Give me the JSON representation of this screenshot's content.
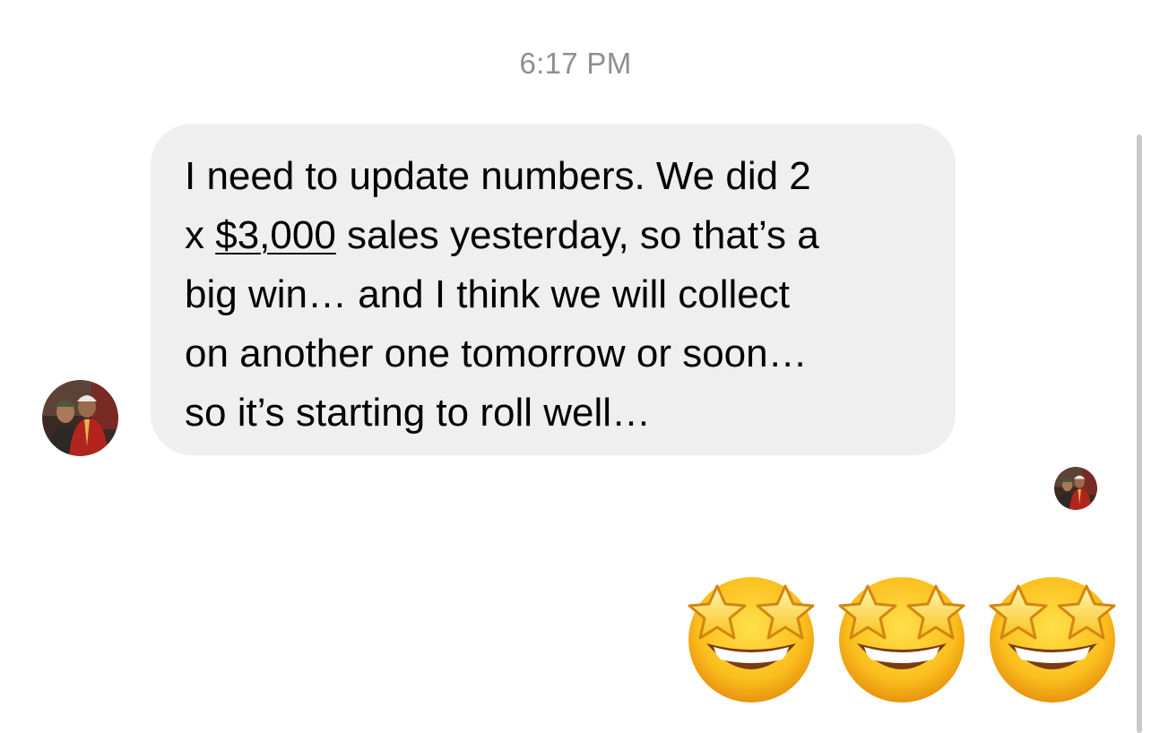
{
  "conversation": {
    "timestamp": "6:17 PM",
    "incoming_message": {
      "lines": [
        "I need to update numbers.  We did 2",
        "x ",
        "$3,000",
        " sales yesterday, so that’s a",
        "big win… and I think we will collect",
        "on another one tomorrow or soon…",
        "so it’s starting to roll well…"
      ],
      "linked_amount": "$3,000",
      "bubble_color": "#efefef",
      "sender_avatar": "avatar-photo-icon"
    },
    "reaction_emojis": [
      {
        "icon": "star-struck-emoji-icon"
      },
      {
        "icon": "star-struck-emoji-icon"
      },
      {
        "icon": "star-struck-emoji-icon"
      }
    ],
    "read_receipt_avatar": "avatar-photo-icon"
  },
  "colors": {
    "timestamp": "#8e8e93",
    "text": "#000000",
    "background": "#ffffff"
  }
}
